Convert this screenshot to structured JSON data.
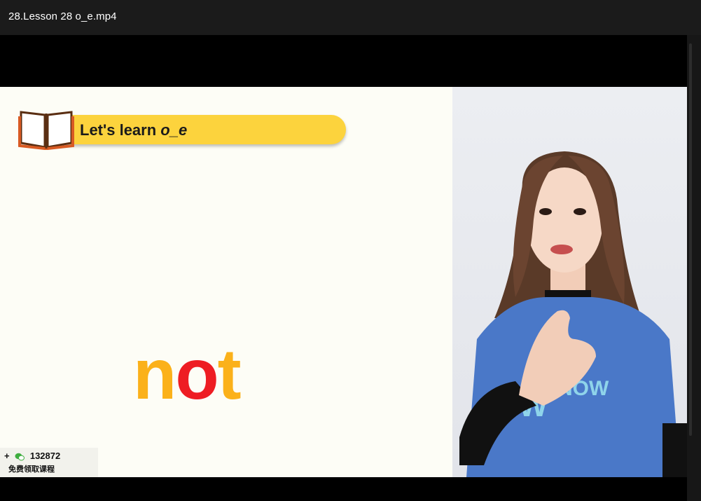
{
  "window": {
    "title": "28.Lesson 28 o_e.mp4"
  },
  "slide": {
    "banner": {
      "prefix": "Let's learn ",
      "pattern": "o_e"
    },
    "word": {
      "part1": "n",
      "part2": "o",
      "part3": "t"
    },
    "promo": {
      "plus": "+",
      "number": "132872",
      "caption": "免费领取课程"
    }
  },
  "colors": {
    "banner": "#fcd33d",
    "letter_yellow": "#fbb11a",
    "letter_red": "#ee1d23",
    "shirt_blue": "#4a78c8"
  },
  "icons": {
    "book": "open-book-icon",
    "wechat": "wechat-icon"
  }
}
